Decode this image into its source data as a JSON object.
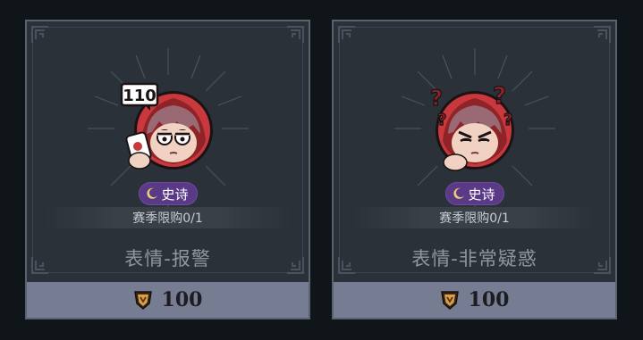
{
  "colors": {
    "card_bg": "#2b3138",
    "card_border": "#59626d",
    "rarity_epic": "#5a3a86",
    "price_bar": "#767d92",
    "hood_red": "#c8383c"
  },
  "cards": [
    {
      "icon": "emote-police-icon",
      "badge_text": "110",
      "rarity": "史诗",
      "limit": "赛季限购0/1",
      "name": "表情-报警",
      "currency_icon": "currency-shield-icon",
      "price": "100"
    },
    {
      "icon": "emote-confused-icon",
      "rarity": "史诗",
      "limit": "赛季限购0/1",
      "name": "表情-非常疑惑",
      "currency_icon": "currency-shield-icon",
      "price": "100"
    }
  ]
}
